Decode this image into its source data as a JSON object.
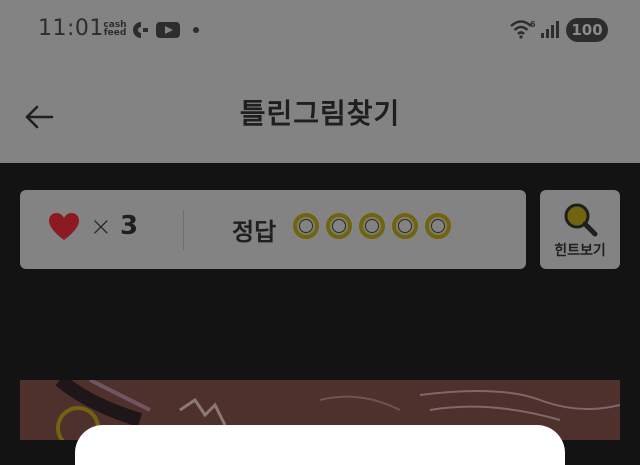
{
  "status_bar": {
    "time": "11:01",
    "notification_app": "cash feed",
    "icons": [
      "cashfeed-icon",
      "c-app-icon",
      "youtube-icon",
      "notification-dot",
      "wifi-icon",
      "cellular-signal-icon"
    ],
    "battery": "100"
  },
  "header": {
    "title": "틀린그림찾기",
    "back_icon": "arrow-left-icon"
  },
  "game_info": {
    "lives_icon": "heart-icon",
    "lives_multiplier": "×",
    "lives_count": "3",
    "answer_label": "정답",
    "answers_found": 0,
    "answers_total": 5
  },
  "hint": {
    "label": "힌트보기",
    "icon": "magnifier-icon"
  },
  "colors": {
    "dim_overlay_bg": "#838383",
    "heart": "#8c1a22",
    "circle_gold": "#726311",
    "background": "#131313"
  }
}
